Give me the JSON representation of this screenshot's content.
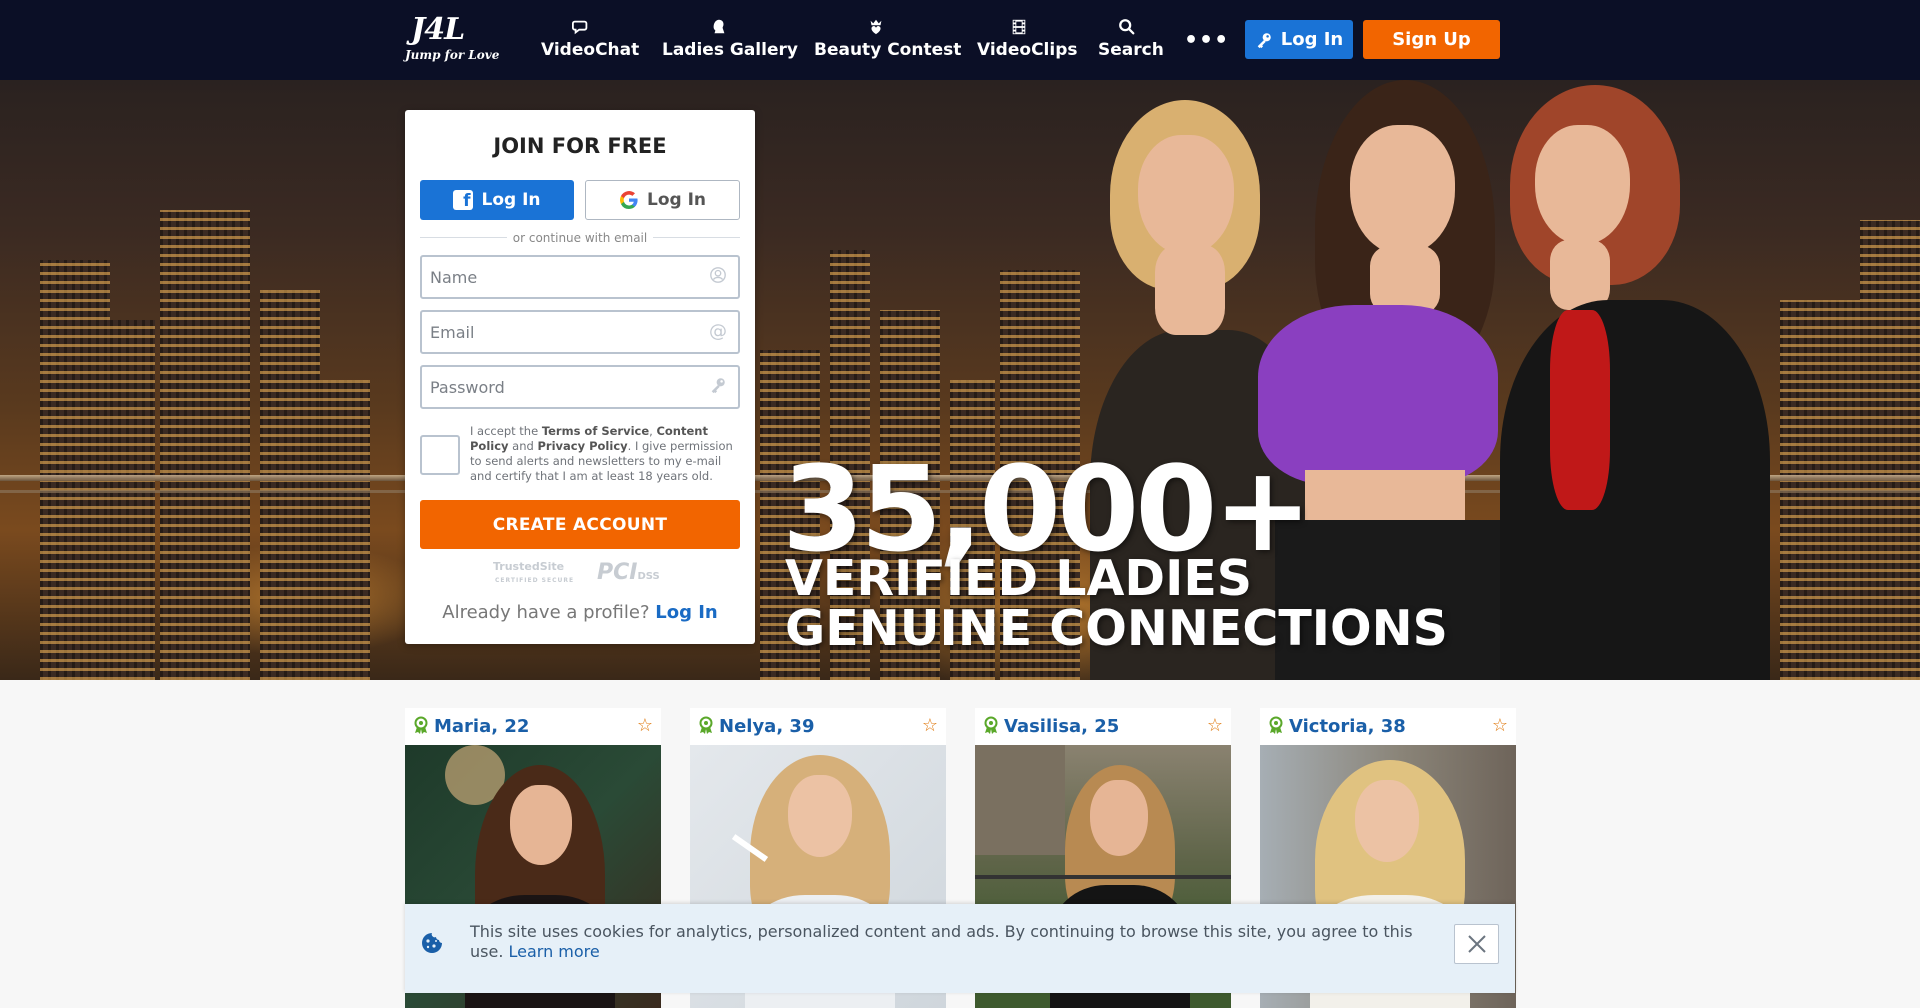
{
  "header": {
    "logo_main": "J4L",
    "logo_sub": "Jump for Love",
    "nav": [
      {
        "label": "VideoChat",
        "icon": "chat-bubbles-icon"
      },
      {
        "label": "Ladies Gallery",
        "icon": "lady-profile-icon"
      },
      {
        "label": "Beauty Contest",
        "icon": "crown-heart-icon"
      },
      {
        "label": "VideoClips",
        "icon": "film-icon"
      },
      {
        "label": "Search",
        "icon": "search-icon"
      }
    ],
    "more_label": "•••",
    "login_label": "Log In",
    "signup_label": "Sign Up"
  },
  "hero": {
    "headline": "35,000+",
    "line1": "VERIFIED LADIES",
    "line2": "GENUINE CONNECTIONS"
  },
  "join": {
    "title": "JOIN FOR FREE",
    "facebook_label": "Log In",
    "google_label": "Log In",
    "divider_text": "or continue with email",
    "name_placeholder": "Name",
    "email_placeholder": "Email",
    "password_placeholder": "Password",
    "terms": {
      "p1": "I accept the ",
      "tos": "Terms of Service",
      "comma": ", ",
      "content_policy": "Content Policy",
      "and": " and ",
      "privacy": "Privacy Policy",
      "p2": ". I give permission to send alerts and newsletters to my e-mail and certify that I am at least 18 years old."
    },
    "create_label": "CREATE ACCOUNT",
    "trusted_site": "TrustedSite",
    "trusted_sub": "CERTIFIED SECURE",
    "pci_main": "PCI",
    "pci_sub": "DSS",
    "already_text": "Already have a profile? ",
    "already_link": "Log In"
  },
  "profiles": [
    {
      "name": "Maria, 22"
    },
    {
      "name": "Nelya, 39"
    },
    {
      "name": "Vasilisa, 25"
    },
    {
      "name": "Victoria, 38"
    }
  ],
  "cookie": {
    "text": "This site uses cookies for analytics, personalized content and ads. By continuing to browse this site, you agree to this use. ",
    "link": "Learn more"
  },
  "colors": {
    "header_bg": "#0b0f26",
    "accent_blue": "#1a73d6",
    "accent_orange": "#f26500",
    "link_blue": "#1a5fa8"
  }
}
